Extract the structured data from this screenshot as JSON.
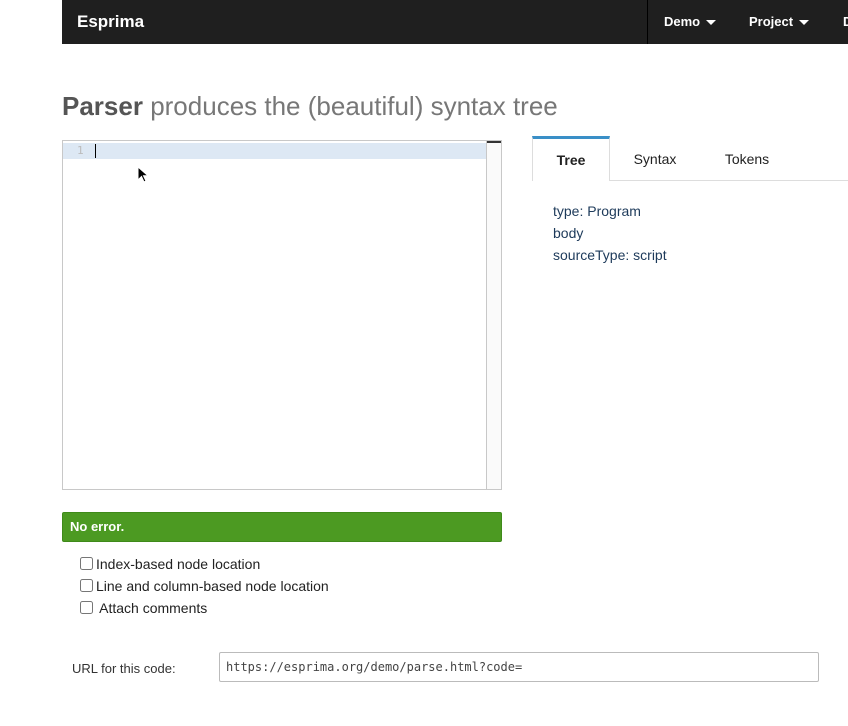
{
  "navbar": {
    "brand": "Esprima",
    "items": [
      {
        "label": "Demo"
      },
      {
        "label": "Project"
      },
      {
        "label": "D"
      }
    ]
  },
  "heading": {
    "strong": "Parser",
    "rest": " produces the (beautiful) syntax tree"
  },
  "editor": {
    "line_numbers": [
      "1"
    ],
    "content": ""
  },
  "status": {
    "text": "No error.",
    "color": "#4c9a22"
  },
  "options": [
    {
      "label": "Index-based node location",
      "checked": false
    },
    {
      "label": "Line and column-based node location",
      "checked": false
    },
    {
      "label": " Attach comments",
      "checked": false
    }
  ],
  "url": {
    "label": "URL for this code:",
    "value": "https://esprima.org/demo/parse.html?code="
  },
  "tabs": [
    {
      "label": "Tree",
      "active": true
    },
    {
      "label": "Syntax",
      "active": false
    },
    {
      "label": "Tokens",
      "active": false
    }
  ],
  "tree": {
    "lines": [
      "type: Program",
      "body",
      "sourceType: script"
    ]
  },
  "colors": {
    "navbar": "#1f1f1f",
    "accent_tab": "#3a8fc7"
  }
}
